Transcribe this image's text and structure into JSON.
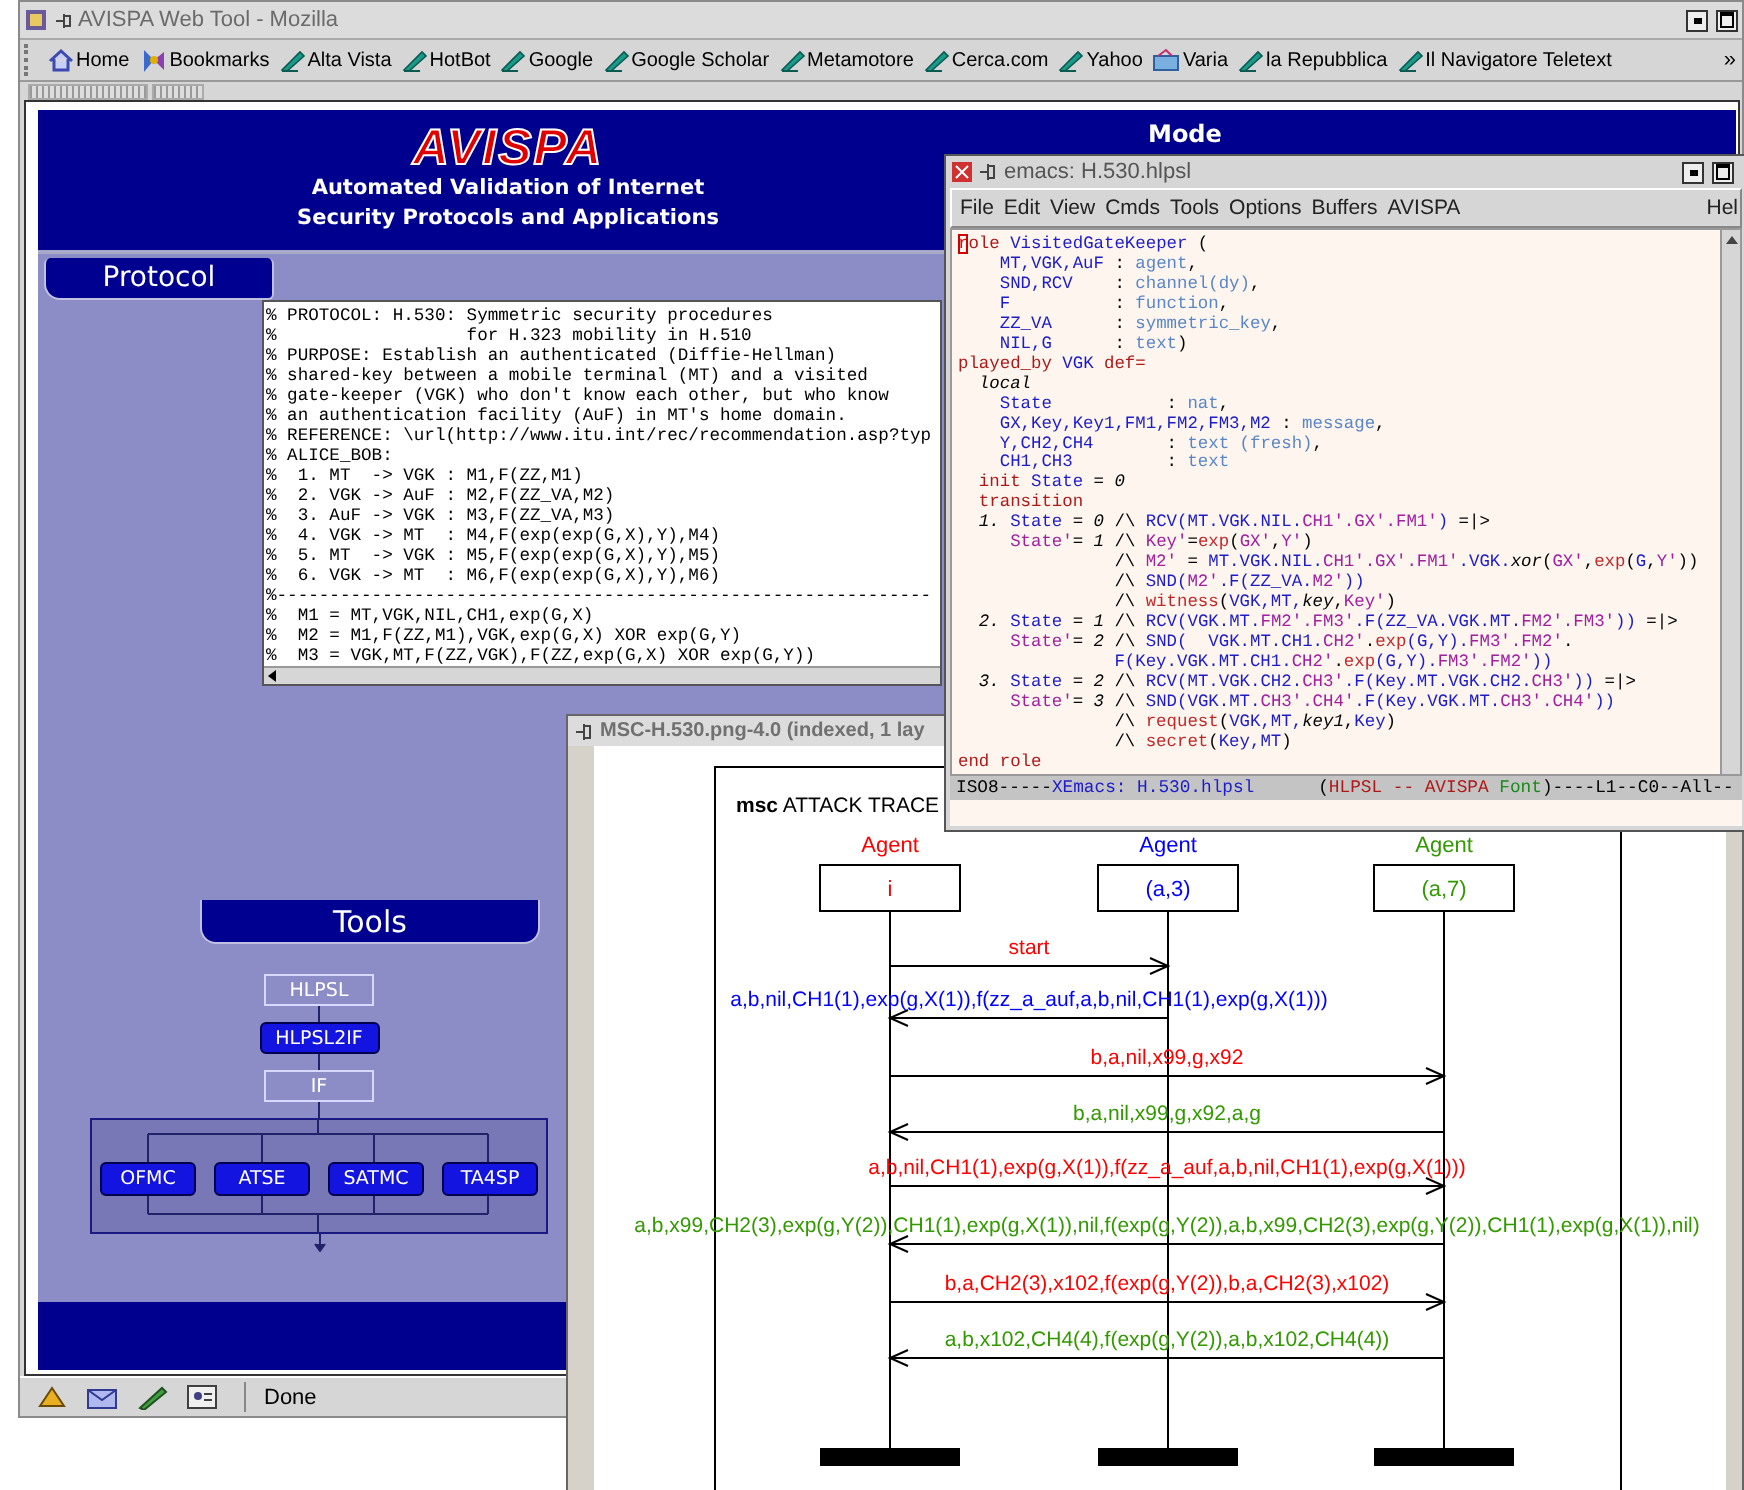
{
  "browser": {
    "title": "AVISPA Web Tool - Mozilla",
    "bookmarks": [
      {
        "label": "Home",
        "kind": "home"
      },
      {
        "label": "Bookmarks",
        "kind": "menu"
      },
      {
        "label": "Alta Vista",
        "kind": "link"
      },
      {
        "label": "HotBot",
        "kind": "link"
      },
      {
        "label": "Google",
        "kind": "link"
      },
      {
        "label": "Google Scholar",
        "kind": "link"
      },
      {
        "label": "Metamotore",
        "kind": "link"
      },
      {
        "label": "Cerca.com",
        "kind": "link"
      },
      {
        "label": "Yahoo",
        "kind": "link"
      },
      {
        "label": "Varia",
        "kind": "folder"
      },
      {
        "label": "la Repubblica",
        "kind": "link"
      },
      {
        "label": "Il Navigatore Teletext",
        "kind": "link"
      }
    ],
    "overflow": "»",
    "status": "Done"
  },
  "page": {
    "logo": "AVISPA",
    "subtitle": [
      "Automated Validation of Internet",
      "Security Protocols and Applications"
    ],
    "mode_label": "Mode",
    "protocol_tab": "Protocol",
    "protocol_text": [
      "% PROTOCOL: H.530: Symmetric security procedures",
      "%                  for H.323 mobility in H.510",
      "% PURPOSE: Establish an authenticated (Diffie-Hellman)",
      "% shared-key between a mobile terminal (MT) and a visited",
      "% gate-keeper (VGK) who don't know each other, but who know",
      "% an authentication facility (AuF) in MT's home domain.",
      "% REFERENCE: \\url(http://www.itu.int/rec/recommendation.asp?typ",
      "% ALICE_BOB:",
      "%  1. MT  -> VGK : M1,F(ZZ,M1)",
      "%  2. VGK -> AuF : M2,F(ZZ_VA,M2)",
      "%  3. AuF -> VGK : M3,F(ZZ_VA,M3)",
      "%  4. VGK -> MT  : M4,F(exp(exp(G,X),Y),M4)",
      "%  5. MT  -> VGK : M5,F(exp(exp(G,X),Y),M5)",
      "%  6. VGK -> MT  : M6,F(exp(exp(G,X),Y),M6)",
      "%--------------------------------------------------------------",
      "%  M1 = MT,VGK,NIL,CH1,exp(G,X)",
      "%  M2 = M1,F(ZZ,M1),VGK,exp(G,X) XOR exp(G,Y)",
      "%  M3 = VGK,MT,F(ZZ,VGK),F(ZZ,exp(G,X) XOR exp(G,Y))"
    ],
    "tools_tab": "Tools",
    "pipeline": [
      {
        "label": "HLPSL",
        "selected": false
      },
      {
        "label": "HLPSL2IF",
        "selected": true
      },
      {
        "label": "IF",
        "selected": false
      }
    ],
    "backends": [
      "OFMC",
      "ATSE",
      "SATMC",
      "TA4SP"
    ]
  },
  "emacs": {
    "title": "emacs: H.530.hlpsl",
    "menu": [
      "File",
      "Edit",
      "View",
      "Cmds",
      "Tools",
      "Options",
      "Buffers",
      "AVISPA"
    ],
    "menu_right": "Hel",
    "lines": [
      [
        {
          "kind": "cursor",
          "text": "r"
        },
        {
          "kind": "kw",
          "text": "ole "
        },
        {
          "kind": "id",
          "text": "VisitedGateKeeper"
        },
        {
          "kind": "plain",
          "text": " ("
        }
      ],
      [
        {
          "kind": "id",
          "text": "    MT,VGK,AuF"
        },
        {
          "kind": "plain",
          "text": " : "
        },
        {
          "kind": "type",
          "text": "agent"
        },
        {
          "kind": "plain",
          "text": ","
        }
      ],
      [
        {
          "kind": "id",
          "text": "    SND,RCV"
        },
        {
          "kind": "plain",
          "text": "    : "
        },
        {
          "kind": "type",
          "text": "channel(dy)"
        },
        {
          "kind": "plain",
          "text": ","
        }
      ],
      [
        {
          "kind": "id",
          "text": "    F"
        },
        {
          "kind": "plain",
          "text": "          : "
        },
        {
          "kind": "type",
          "text": "function"
        },
        {
          "kind": "plain",
          "text": ","
        }
      ],
      [
        {
          "kind": "id",
          "text": "    ZZ_VA"
        },
        {
          "kind": "plain",
          "text": "      : "
        },
        {
          "kind": "type",
          "text": "symmetric_key"
        },
        {
          "kind": "plain",
          "text": ","
        }
      ],
      [
        {
          "kind": "id",
          "text": "    NIL,G"
        },
        {
          "kind": "plain",
          "text": "      : "
        },
        {
          "kind": "type",
          "text": "text"
        },
        {
          "kind": "plain",
          "text": ")"
        }
      ],
      [
        {
          "kind": "kw",
          "text": "played_by "
        },
        {
          "kind": "id",
          "text": "VGK"
        },
        {
          "kind": "kw",
          "text": " def="
        }
      ],
      [
        {
          "kind": "italic",
          "text": "  local"
        }
      ],
      [
        {
          "kind": "id",
          "text": "    State"
        },
        {
          "kind": "plain",
          "text": "           : "
        },
        {
          "kind": "type",
          "text": "nat"
        },
        {
          "kind": "plain",
          "text": ","
        }
      ],
      [
        {
          "kind": "id",
          "text": "    GX,Key,Key1,FM1,FM2,FM3,M2"
        },
        {
          "kind": "plain",
          "text": " : "
        },
        {
          "kind": "type",
          "text": "message"
        },
        {
          "kind": "plain",
          "text": ","
        }
      ],
      [
        {
          "kind": "id",
          "text": "    Y,CH2,CH4"
        },
        {
          "kind": "plain",
          "text": "       : "
        },
        {
          "kind": "type",
          "text": "text (fresh)"
        },
        {
          "kind": "plain",
          "text": ","
        }
      ],
      [
        {
          "kind": "id",
          "text": "    CH1,CH3"
        },
        {
          "kind": "plain",
          "text": "         : "
        },
        {
          "kind": "type",
          "text": "text"
        }
      ],
      [
        {
          "kind": "kw",
          "text": "  init "
        },
        {
          "kind": "id",
          "text": "State"
        },
        {
          "kind": "plain",
          "text": " = "
        },
        {
          "kind": "italic",
          "text": "0"
        }
      ],
      [
        {
          "kind": "kw",
          "text": "  transition"
        }
      ],
      [
        {
          "kind": "italic",
          "text": "  1. "
        },
        {
          "kind": "id",
          "text": "State"
        },
        {
          "kind": "plain",
          "text": " = "
        },
        {
          "kind": "italic",
          "text": "0"
        },
        {
          "kind": "plain",
          "text": " /\\ "
        },
        {
          "kind": "id",
          "text": "RCV(MT.VGK.NIL."
        },
        {
          "kind": "prime",
          "text": "CH1'.GX'.FM1'"
        },
        {
          "kind": "id",
          "text": ")"
        },
        {
          "kind": "plain",
          "text": " =|>"
        }
      ],
      [
        {
          "kind": "prime",
          "text": "     State'"
        },
        {
          "kind": "plain",
          "text": "= "
        },
        {
          "kind": "italic",
          "text": "1"
        },
        {
          "kind": "plain",
          "text": " /\\ "
        },
        {
          "kind": "prime",
          "text": "Key'"
        },
        {
          "kind": "plain",
          "text": "="
        },
        {
          "kind": "func",
          "text": "exp"
        },
        {
          "kind": "plain",
          "text": "("
        },
        {
          "kind": "prime",
          "text": "GX'"
        },
        {
          "kind": "plain",
          "text": ","
        },
        {
          "kind": "prime",
          "text": "Y'"
        },
        {
          "kind": "plain",
          "text": ")"
        }
      ],
      [
        {
          "kind": "plain",
          "text": "               /\\ "
        },
        {
          "kind": "prime",
          "text": "M2'"
        },
        {
          "kind": "plain",
          "text": " = "
        },
        {
          "kind": "id",
          "text": "MT.VGK.NIL."
        },
        {
          "kind": "prime",
          "text": "CH1'.GX'.FM1'"
        },
        {
          "kind": "id",
          "text": ".VGK."
        },
        {
          "kind": "italic",
          "text": "xor"
        },
        {
          "kind": "plain",
          "text": "("
        },
        {
          "kind": "prime",
          "text": "GX'"
        },
        {
          "kind": "plain",
          "text": ","
        },
        {
          "kind": "func",
          "text": "exp"
        },
        {
          "kind": "plain",
          "text": "("
        },
        {
          "kind": "id",
          "text": "G"
        },
        {
          "kind": "plain",
          "text": ","
        },
        {
          "kind": "prime",
          "text": "Y'"
        },
        {
          "kind": "plain",
          "text": "))"
        }
      ],
      [
        {
          "kind": "plain",
          "text": "               /\\ "
        },
        {
          "kind": "id",
          "text": "SND("
        },
        {
          "kind": "prime",
          "text": "M2'"
        },
        {
          "kind": "id",
          "text": ".F(ZZ_VA."
        },
        {
          "kind": "prime",
          "text": "M2'"
        },
        {
          "kind": "id",
          "text": "))"
        }
      ],
      [
        {
          "kind": "plain",
          "text": "               /\\ "
        },
        {
          "kind": "func",
          "text": "witness"
        },
        {
          "kind": "plain",
          "text": "("
        },
        {
          "kind": "id",
          "text": "VGK,MT,"
        },
        {
          "kind": "italic",
          "text": "key"
        },
        {
          "kind": "plain",
          "text": ","
        },
        {
          "kind": "prime",
          "text": "Key'"
        },
        {
          "kind": "plain",
          "text": ")"
        }
      ],
      [
        {
          "kind": "italic",
          "text": "  2. "
        },
        {
          "kind": "id",
          "text": "State"
        },
        {
          "kind": "plain",
          "text": " = "
        },
        {
          "kind": "italic",
          "text": "1"
        },
        {
          "kind": "plain",
          "text": " /\\ "
        },
        {
          "kind": "id",
          "text": "RCV(VGK.MT."
        },
        {
          "kind": "prime",
          "text": "FM2'.FM3'"
        },
        {
          "kind": "id",
          "text": ".F(ZZ_VA.VGK.MT."
        },
        {
          "kind": "prime",
          "text": "FM2'.FM3'"
        },
        {
          "kind": "id",
          "text": "))"
        },
        {
          "kind": "plain",
          "text": " =|>"
        }
      ],
      [
        {
          "kind": "prime",
          "text": "     State'"
        },
        {
          "kind": "plain",
          "text": "= "
        },
        {
          "kind": "italic",
          "text": "2"
        },
        {
          "kind": "plain",
          "text": " /\\ "
        },
        {
          "kind": "id",
          "text": "SND(  VGK.MT.CH1."
        },
        {
          "kind": "prime",
          "text": "CH2'"
        },
        {
          "kind": "plain",
          "text": "."
        },
        {
          "kind": "func",
          "text": "exp"
        },
        {
          "kind": "id",
          "text": "(G,Y)."
        },
        {
          "kind": "prime",
          "text": "FM3'.FM2'"
        },
        {
          "kind": "plain",
          "text": "."
        }
      ],
      [
        {
          "kind": "id",
          "text": "               F(Key.VGK.MT.CH1."
        },
        {
          "kind": "prime",
          "text": "CH2'"
        },
        {
          "kind": "plain",
          "text": "."
        },
        {
          "kind": "func",
          "text": "exp"
        },
        {
          "kind": "id",
          "text": "(G,Y)."
        },
        {
          "kind": "prime",
          "text": "FM3'.FM2'"
        },
        {
          "kind": "id",
          "text": "))"
        }
      ],
      [
        {
          "kind": "italic",
          "text": "  3. "
        },
        {
          "kind": "id",
          "text": "State"
        },
        {
          "kind": "plain",
          "text": " = "
        },
        {
          "kind": "italic",
          "text": "2"
        },
        {
          "kind": "plain",
          "text": " /\\ "
        },
        {
          "kind": "id",
          "text": "RCV(MT.VGK.CH2."
        },
        {
          "kind": "prime",
          "text": "CH3'"
        },
        {
          "kind": "id",
          "text": ".F(Key.MT.VGK.CH2."
        },
        {
          "kind": "prime",
          "text": "CH3'"
        },
        {
          "kind": "id",
          "text": "))"
        },
        {
          "kind": "plain",
          "text": " =|>"
        }
      ],
      [
        {
          "kind": "prime",
          "text": "     State'"
        },
        {
          "kind": "plain",
          "text": "= "
        },
        {
          "kind": "italic",
          "text": "3"
        },
        {
          "kind": "plain",
          "text": " /\\ "
        },
        {
          "kind": "id",
          "text": "SND(VGK.MT."
        },
        {
          "kind": "prime",
          "text": "CH3'.CH4'"
        },
        {
          "kind": "id",
          "text": ".F(Key.VGK.MT."
        },
        {
          "kind": "prime",
          "text": "CH3'.CH4'"
        },
        {
          "kind": "id",
          "text": "))"
        }
      ],
      [
        {
          "kind": "plain",
          "text": "               /\\ "
        },
        {
          "kind": "func",
          "text": "request"
        },
        {
          "kind": "plain",
          "text": "("
        },
        {
          "kind": "id",
          "text": "VGK,MT,"
        },
        {
          "kind": "italic",
          "text": "key1"
        },
        {
          "kind": "plain",
          "text": ","
        },
        {
          "kind": "id",
          "text": "Key"
        },
        {
          "kind": "plain",
          "text": ")"
        }
      ],
      [
        {
          "kind": "plain",
          "text": "               /\\ "
        },
        {
          "kind": "func",
          "text": "secret"
        },
        {
          "kind": "plain",
          "text": "("
        },
        {
          "kind": "id",
          "text": "Key,MT"
        },
        {
          "kind": "plain",
          "text": ")"
        }
      ],
      [
        {
          "kind": "kw",
          "text": "end role"
        }
      ]
    ],
    "mode_line": [
      {
        "kind": "plain",
        "text": "ISO8-----"
      },
      {
        "kind": "id",
        "text": "XEmacs: H.530.hlpsl"
      },
      {
        "kind": "plain",
        "text": "      ("
      },
      {
        "kind": "kw",
        "text": "HLPSL -- AVISPA"
      },
      {
        "kind": "green",
        "text": " Font"
      },
      {
        "kind": "plain",
        "text": ")----L1--C0--All--"
      }
    ]
  },
  "msc": {
    "title": "MSC-H.530.png-4.0 (indexed, 1 lay",
    "heading": "**msc** ATTACK TRACE",
    "agents": [
      {
        "role": "Agent",
        "name": "i",
        "color": "#ff0000"
      },
      {
        "role": "Agent",
        "name": "(a,3)",
        "color": "#0000ff"
      },
      {
        "role": "Agent",
        "name": "(a,7)",
        "color": "#339900"
      }
    ],
    "messages": [
      {
        "label": "start",
        "kind": "right_short",
        "color": "#ff0000"
      },
      {
        "label": "a,b,nil,CH1(1),exp(g,X(1)),f(zz_a_auf,a,b,nil,CH1(1),exp(g,X(1)))",
        "kind": "left_short",
        "color": "#0000ff"
      },
      {
        "label": "b,a,nil,x99,g,x92",
        "kind": "right_long",
        "color": "#ff0000"
      },
      {
        "label": "b,a,nil,x99,g,x92,a,g",
        "kind": "left_long",
        "color": "#339900"
      },
      {
        "label": "a,b,nil,CH1(1),exp(g,X(1)),f(zz_a_auf,a,b,nil,CH1(1),exp(g,X(1)))",
        "kind": "right_long",
        "color": "#ff0000"
      },
      {
        "label": "a,b,x99,CH2(3),exp(g,Y(2)),CH1(1),exp(g,X(1)),nil,f(exp(g,Y(2)),a,b,x99,CH2(3),exp(g,Y(2)),CH1(1),exp(g,X(1)),nil)",
        "kind": "left_long",
        "color": "#339900"
      },
      {
        "label": "b,a,CH2(3),x102,f(exp(g,Y(2)),b,a,CH2(3),x102)",
        "kind": "right_long",
        "color": "#ff0000"
      },
      {
        "label": "a,b,x102,CH4(4),f(exp(g,Y(2)),a,b,x102,CH4(4))",
        "kind": "left_long",
        "color": "#339900"
      }
    ]
  }
}
